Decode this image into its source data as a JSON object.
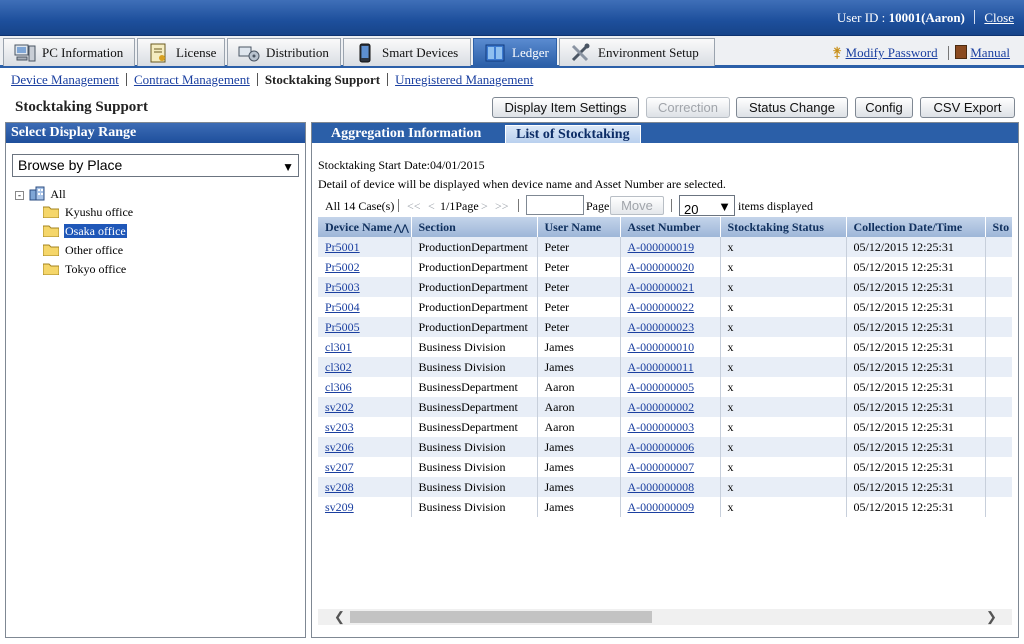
{
  "header": {
    "user_prefix": "User ID :",
    "user_value": "10001(Aaron)",
    "close_label": "Close"
  },
  "main_tabs": [
    {
      "label": "PC Information",
      "icon": "pc-icon"
    },
    {
      "label": "License",
      "icon": "license-icon"
    },
    {
      "label": "Distribution",
      "icon": "distribution-icon"
    },
    {
      "label": "Smart Devices",
      "icon": "smartphone-icon"
    },
    {
      "label": "Ledger",
      "icon": "ledger-icon",
      "active": true
    },
    {
      "label": "Environment Setup",
      "icon": "tools-icon"
    }
  ],
  "top_links": {
    "modify_password": "Modify Password",
    "manual": "Manual"
  },
  "submenu": {
    "device_management": "Device Management",
    "contract_management": "Contract Management",
    "stocktaking_support": "Stocktaking Support",
    "unregistered_management": "Unregistered Management"
  },
  "page": {
    "title": "Stocktaking Support",
    "buttons": {
      "display_item_settings": "Display Item Settings",
      "correction": "Correction",
      "status_change": "Status Change",
      "config": "Config",
      "csv_export": "CSV Export"
    }
  },
  "left_panel": {
    "title": "Select Display Range",
    "browse_select": "Browse by Place",
    "tree": {
      "root": "All",
      "children": [
        "Kyushu office",
        "Osaka office",
        "Other office",
        "Tokyo office"
      ],
      "selected": "Osaka office"
    }
  },
  "right_panel": {
    "tabs": [
      "Aggregation Information",
      "List of Stocktaking"
    ],
    "active_tab": "List of Stocktaking",
    "start_date": "Stocktaking Start Date:04/01/2015",
    "detail_note": "Detail of device will be displayed when device name and Asset Number are selected.",
    "pager": {
      "count": "All 14 Case(s)",
      "first": "<<",
      "prev": "<",
      "page_info": "1/1Page",
      "next": ">",
      "last": ">>",
      "page_label": "Page",
      "move": "Move",
      "per_page": "20",
      "items_displayed": "items displayed"
    },
    "columns": [
      "Device Name",
      "Section",
      "User Name",
      "Asset Number",
      "Stocktaking Status",
      "Collection Date/Time",
      "Sto"
    ],
    "sort_indicator": "sort-ascending-icon",
    "rows": [
      [
        "Pr5001",
        "ProductionDepartment",
        "Peter",
        "A-000000019",
        "x",
        "05/12/2015 12:25:31"
      ],
      [
        "Pr5002",
        "ProductionDepartment",
        "Peter",
        "A-000000020",
        "x",
        "05/12/2015 12:25:31"
      ],
      [
        "Pr5003",
        "ProductionDepartment",
        "Peter",
        "A-000000021",
        "x",
        "05/12/2015 12:25:31"
      ],
      [
        "Pr5004",
        "ProductionDepartment",
        "Peter",
        "A-000000022",
        "x",
        "05/12/2015 12:25:31"
      ],
      [
        "Pr5005",
        "ProductionDepartment",
        "Peter",
        "A-000000023",
        "x",
        "05/12/2015 12:25:31"
      ],
      [
        "cl301",
        "Business Division",
        "James",
        "A-000000010",
        "x",
        "05/12/2015 12:25:31"
      ],
      [
        "cl302",
        "Business Division",
        "James",
        "A-000000011",
        "x",
        "05/12/2015 12:25:31"
      ],
      [
        "cl306",
        "BusinessDepartment",
        "Aaron",
        "A-000000005",
        "x",
        "05/12/2015 12:25:31"
      ],
      [
        "sv202",
        "BusinessDepartment",
        "Aaron",
        "A-000000002",
        "x",
        "05/12/2015 12:25:31"
      ],
      [
        "sv203",
        "BusinessDepartment",
        "Aaron",
        "A-000000003",
        "x",
        "05/12/2015 12:25:31"
      ],
      [
        "sv206",
        "Business Division",
        "James",
        "A-000000006",
        "x",
        "05/12/2015 12:25:31"
      ],
      [
        "sv207",
        "Business Division",
        "James",
        "A-000000007",
        "x",
        "05/12/2015 12:25:31"
      ],
      [
        "sv208",
        "Business Division",
        "James",
        "A-000000008",
        "x",
        "05/12/2015 12:25:31"
      ],
      [
        "sv209",
        "Business Division",
        "James",
        "A-000000009",
        "x",
        "05/12/2015 12:25:31"
      ]
    ]
  },
  "colors": {
    "header_blue": "#1d4f9c",
    "link_blue": "#1a3fa0",
    "selection_blue": "#1f57b8",
    "row_alt": "#e8eef7"
  }
}
